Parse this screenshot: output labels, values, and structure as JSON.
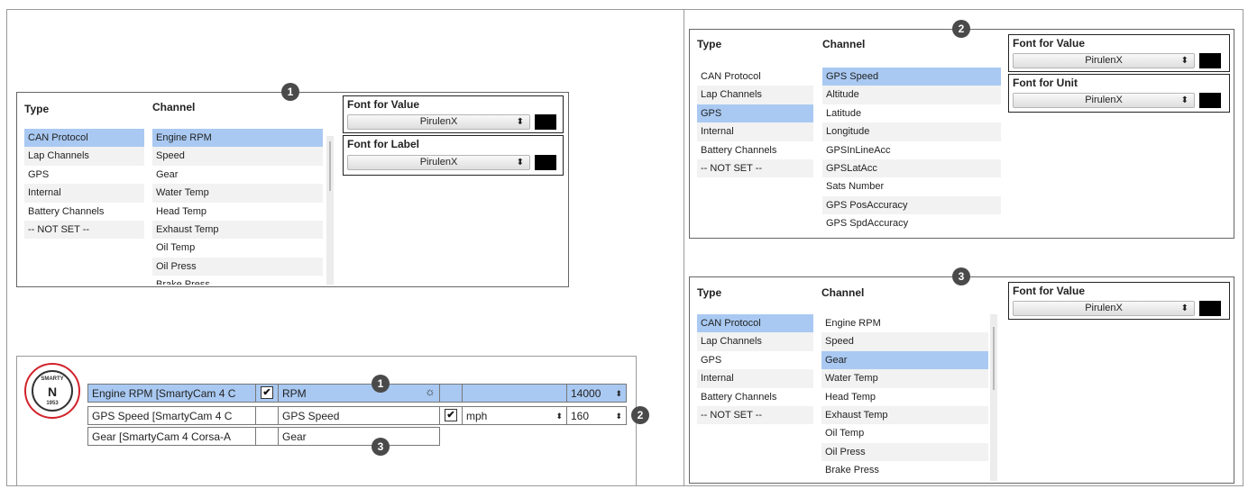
{
  "panel_left": {
    "type_header": "Type",
    "channel_header": "Channel",
    "types": [
      "CAN Protocol",
      "Lap Channels",
      "GPS",
      "Internal",
      "Battery Channels",
      "-- NOT SET --"
    ],
    "channels": [
      "Engine RPM",
      "Speed",
      "Gear",
      "Water Temp",
      "Head Temp",
      "Exhaust Temp",
      "Oil Temp",
      "Oil Press",
      "Brake Press"
    ],
    "font_value_label": "Font for Value",
    "font_value": "PirulenX",
    "font_label_label": "Font for Label",
    "font_label": "PirulenX",
    "badge": "1"
  },
  "panel_top_right": {
    "type_header": "Type",
    "channel_header": "Channel",
    "types": [
      "CAN Protocol",
      "Lap Channels",
      "GPS",
      "Internal",
      "Battery Channels",
      "-- NOT SET --"
    ],
    "channels": [
      "GPS Speed",
      "Altitude",
      "Latitude",
      "Longitude",
      "GPSInLineAcc",
      "GPSLatAcc",
      "Sats Number",
      "GPS PosAccuracy",
      "GPS SpdAccuracy"
    ],
    "font_value_label": "Font for Value",
    "font_value": "PirulenX",
    "font_unit_label": "Font for Unit",
    "font_unit": "PirulenX",
    "badge": "2"
  },
  "panel_bottom_right": {
    "type_header": "Type",
    "channel_header": "Channel",
    "types": [
      "CAN Protocol",
      "Lap Channels",
      "GPS",
      "Internal",
      "Battery Channels",
      "-- NOT SET --"
    ],
    "channels": [
      "Engine RPM",
      "Speed",
      "Gear",
      "Water Temp",
      "Head Temp",
      "Exhaust Temp",
      "Oil Temp",
      "Oil Press",
      "Brake Press"
    ],
    "font_value_label": "Font for Value",
    "font_value": "PirulenX",
    "badge": "3"
  },
  "table": {
    "rows": [
      {
        "source": "Engine RPM  [SmartyCam 4 C",
        "label": "RPM",
        "unit": "",
        "max": "14000"
      },
      {
        "source": "GPS Speed  [SmartyCam 4 C",
        "label": "GPS Speed",
        "unit": "mph",
        "max": "160"
      },
      {
        "source": "Gear  [SmartyCam 4 Corsa-A",
        "label": "Gear"
      }
    ],
    "badges": [
      "1",
      "2",
      "3"
    ],
    "check_mark": "✔",
    "spinner": "⬍",
    "select_arrow": "⬍",
    "gear_icon": "☼"
  },
  "logo": {
    "top_text": "SMARTY",
    "letter": "N",
    "bottom_text": "1953"
  },
  "select_arrow": "⬍",
  "colors": {
    "selection": "#a9c9f2",
    "alt_row": "#f2f2f2",
    "badge": "#4a4a4a",
    "logo_ring": "#d2222a"
  }
}
